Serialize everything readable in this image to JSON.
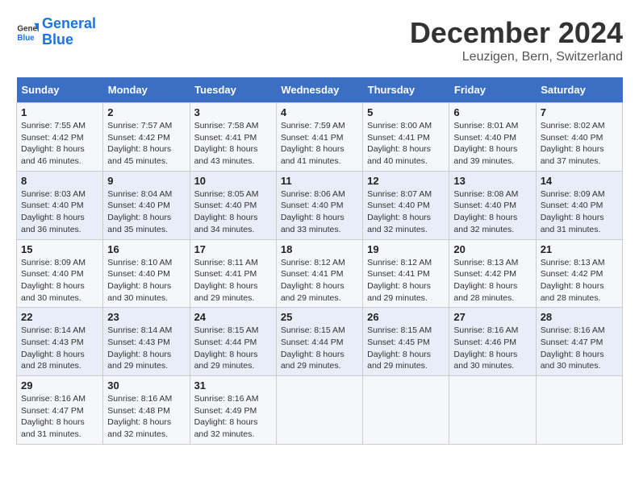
{
  "header": {
    "logo_line1": "General",
    "logo_line2": "Blue",
    "title": "December 2024",
    "subtitle": "Leuzigen, Bern, Switzerland"
  },
  "weekdays": [
    "Sunday",
    "Monday",
    "Tuesday",
    "Wednesday",
    "Thursday",
    "Friday",
    "Saturday"
  ],
  "weeks": [
    [
      {
        "day": "1",
        "sunrise": "Sunrise: 7:55 AM",
        "sunset": "Sunset: 4:42 PM",
        "daylight": "Daylight: 8 hours and 46 minutes."
      },
      {
        "day": "2",
        "sunrise": "Sunrise: 7:57 AM",
        "sunset": "Sunset: 4:42 PM",
        "daylight": "Daylight: 8 hours and 45 minutes."
      },
      {
        "day": "3",
        "sunrise": "Sunrise: 7:58 AM",
        "sunset": "Sunset: 4:41 PM",
        "daylight": "Daylight: 8 hours and 43 minutes."
      },
      {
        "day": "4",
        "sunrise": "Sunrise: 7:59 AM",
        "sunset": "Sunset: 4:41 PM",
        "daylight": "Daylight: 8 hours and 41 minutes."
      },
      {
        "day": "5",
        "sunrise": "Sunrise: 8:00 AM",
        "sunset": "Sunset: 4:41 PM",
        "daylight": "Daylight: 8 hours and 40 minutes."
      },
      {
        "day": "6",
        "sunrise": "Sunrise: 8:01 AM",
        "sunset": "Sunset: 4:40 PM",
        "daylight": "Daylight: 8 hours and 39 minutes."
      },
      {
        "day": "7",
        "sunrise": "Sunrise: 8:02 AM",
        "sunset": "Sunset: 4:40 PM",
        "daylight": "Daylight: 8 hours and 37 minutes."
      }
    ],
    [
      {
        "day": "8",
        "sunrise": "Sunrise: 8:03 AM",
        "sunset": "Sunset: 4:40 PM",
        "daylight": "Daylight: 8 hours and 36 minutes."
      },
      {
        "day": "9",
        "sunrise": "Sunrise: 8:04 AM",
        "sunset": "Sunset: 4:40 PM",
        "daylight": "Daylight: 8 hours and 35 minutes."
      },
      {
        "day": "10",
        "sunrise": "Sunrise: 8:05 AM",
        "sunset": "Sunset: 4:40 PM",
        "daylight": "Daylight: 8 hours and 34 minutes."
      },
      {
        "day": "11",
        "sunrise": "Sunrise: 8:06 AM",
        "sunset": "Sunset: 4:40 PM",
        "daylight": "Daylight: 8 hours and 33 minutes."
      },
      {
        "day": "12",
        "sunrise": "Sunrise: 8:07 AM",
        "sunset": "Sunset: 4:40 PM",
        "daylight": "Daylight: 8 hours and 32 minutes."
      },
      {
        "day": "13",
        "sunrise": "Sunrise: 8:08 AM",
        "sunset": "Sunset: 4:40 PM",
        "daylight": "Daylight: 8 hours and 32 minutes."
      },
      {
        "day": "14",
        "sunrise": "Sunrise: 8:09 AM",
        "sunset": "Sunset: 4:40 PM",
        "daylight": "Daylight: 8 hours and 31 minutes."
      }
    ],
    [
      {
        "day": "15",
        "sunrise": "Sunrise: 8:09 AM",
        "sunset": "Sunset: 4:40 PM",
        "daylight": "Daylight: 8 hours and 30 minutes."
      },
      {
        "day": "16",
        "sunrise": "Sunrise: 8:10 AM",
        "sunset": "Sunset: 4:40 PM",
        "daylight": "Daylight: 8 hours and 30 minutes."
      },
      {
        "day": "17",
        "sunrise": "Sunrise: 8:11 AM",
        "sunset": "Sunset: 4:41 PM",
        "daylight": "Daylight: 8 hours and 29 minutes."
      },
      {
        "day": "18",
        "sunrise": "Sunrise: 8:12 AM",
        "sunset": "Sunset: 4:41 PM",
        "daylight": "Daylight: 8 hours and 29 minutes."
      },
      {
        "day": "19",
        "sunrise": "Sunrise: 8:12 AM",
        "sunset": "Sunset: 4:41 PM",
        "daylight": "Daylight: 8 hours and 29 minutes."
      },
      {
        "day": "20",
        "sunrise": "Sunrise: 8:13 AM",
        "sunset": "Sunset: 4:42 PM",
        "daylight": "Daylight: 8 hours and 28 minutes."
      },
      {
        "day": "21",
        "sunrise": "Sunrise: 8:13 AM",
        "sunset": "Sunset: 4:42 PM",
        "daylight": "Daylight: 8 hours and 28 minutes."
      }
    ],
    [
      {
        "day": "22",
        "sunrise": "Sunrise: 8:14 AM",
        "sunset": "Sunset: 4:43 PM",
        "daylight": "Daylight: 8 hours and 28 minutes."
      },
      {
        "day": "23",
        "sunrise": "Sunrise: 8:14 AM",
        "sunset": "Sunset: 4:43 PM",
        "daylight": "Daylight: 8 hours and 29 minutes."
      },
      {
        "day": "24",
        "sunrise": "Sunrise: 8:15 AM",
        "sunset": "Sunset: 4:44 PM",
        "daylight": "Daylight: 8 hours and 29 minutes."
      },
      {
        "day": "25",
        "sunrise": "Sunrise: 8:15 AM",
        "sunset": "Sunset: 4:44 PM",
        "daylight": "Daylight: 8 hours and 29 minutes."
      },
      {
        "day": "26",
        "sunrise": "Sunrise: 8:15 AM",
        "sunset": "Sunset: 4:45 PM",
        "daylight": "Daylight: 8 hours and 29 minutes."
      },
      {
        "day": "27",
        "sunrise": "Sunrise: 8:16 AM",
        "sunset": "Sunset: 4:46 PM",
        "daylight": "Daylight: 8 hours and 30 minutes."
      },
      {
        "day": "28",
        "sunrise": "Sunrise: 8:16 AM",
        "sunset": "Sunset: 4:47 PM",
        "daylight": "Daylight: 8 hours and 30 minutes."
      }
    ],
    [
      {
        "day": "29",
        "sunrise": "Sunrise: 8:16 AM",
        "sunset": "Sunset: 4:47 PM",
        "daylight": "Daylight: 8 hours and 31 minutes."
      },
      {
        "day": "30",
        "sunrise": "Sunrise: 8:16 AM",
        "sunset": "Sunset: 4:48 PM",
        "daylight": "Daylight: 8 hours and 32 minutes."
      },
      {
        "day": "31",
        "sunrise": "Sunrise: 8:16 AM",
        "sunset": "Sunset: 4:49 PM",
        "daylight": "Daylight: 8 hours and 32 minutes."
      },
      null,
      null,
      null,
      null
    ]
  ]
}
